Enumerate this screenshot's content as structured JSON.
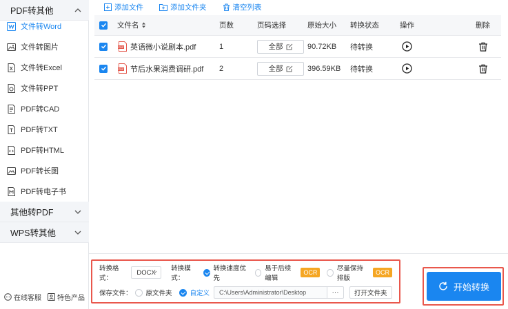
{
  "sidebar": {
    "group_pdf_other": "PDF转其他",
    "items": [
      {
        "label": "文件转Word",
        "icon": "word-icon",
        "active": true
      },
      {
        "label": "文件转图片",
        "icon": "image-icon",
        "active": false
      },
      {
        "label": "文件转Excel",
        "icon": "excel-icon",
        "active": false
      },
      {
        "label": "文件转PPT",
        "icon": "ppt-icon",
        "active": false
      },
      {
        "label": "PDF转CAD",
        "icon": "cad-icon",
        "active": false
      },
      {
        "label": "PDF转TXT",
        "icon": "txt-icon",
        "active": false
      },
      {
        "label": "PDF转HTML",
        "icon": "html-icon",
        "active": false
      },
      {
        "label": "PDF转长图",
        "icon": "long-image-icon",
        "active": false
      },
      {
        "label": "PDF转电子书",
        "icon": "ebook-icon",
        "active": false
      }
    ],
    "group_other_to_pdf": "其他转PDF",
    "group_wps": "WPS转其他",
    "online_service": "在线客服",
    "featured_products": "特色产品"
  },
  "toolbar": {
    "add_file": "添加文件",
    "add_folder": "添加文件夹",
    "clear_list": "清空列表"
  },
  "table": {
    "headers": {
      "filename": "文件名",
      "pages": "页数",
      "page_select": "页码选择",
      "original_size": "原始大小",
      "status": "转换状态",
      "action": "操作",
      "delete": "删除"
    },
    "rows": [
      {
        "filename": "英语微小说剧本.pdf",
        "pages": "1",
        "page_select": "全部",
        "size": "90.72KB",
        "status": "待转换"
      },
      {
        "filename": "节后水果消费调研.pdf",
        "pages": "2",
        "page_select": "全部",
        "size": "396.59KB",
        "status": "待转换"
      }
    ]
  },
  "settings": {
    "format_label": "转换格式：",
    "format_value": "DOCX",
    "mode_label": "转换模式：",
    "mode_options": [
      "转换速度优先",
      "易于后续编辑",
      "尽量保持排版"
    ],
    "ocr_badge": "OCR",
    "save_label": "保存文件：",
    "save_options": [
      "原文件夹",
      "自定义"
    ],
    "save_path": "C:\\Users\\Administrator\\Desktop",
    "browse": "···",
    "open_folder": "打开文件夹"
  },
  "start_button": "开始转换",
  "colors": {
    "accent": "#1a86f0",
    "highlight_border": "#e9574c",
    "ocr_badge": "#f5a623"
  }
}
